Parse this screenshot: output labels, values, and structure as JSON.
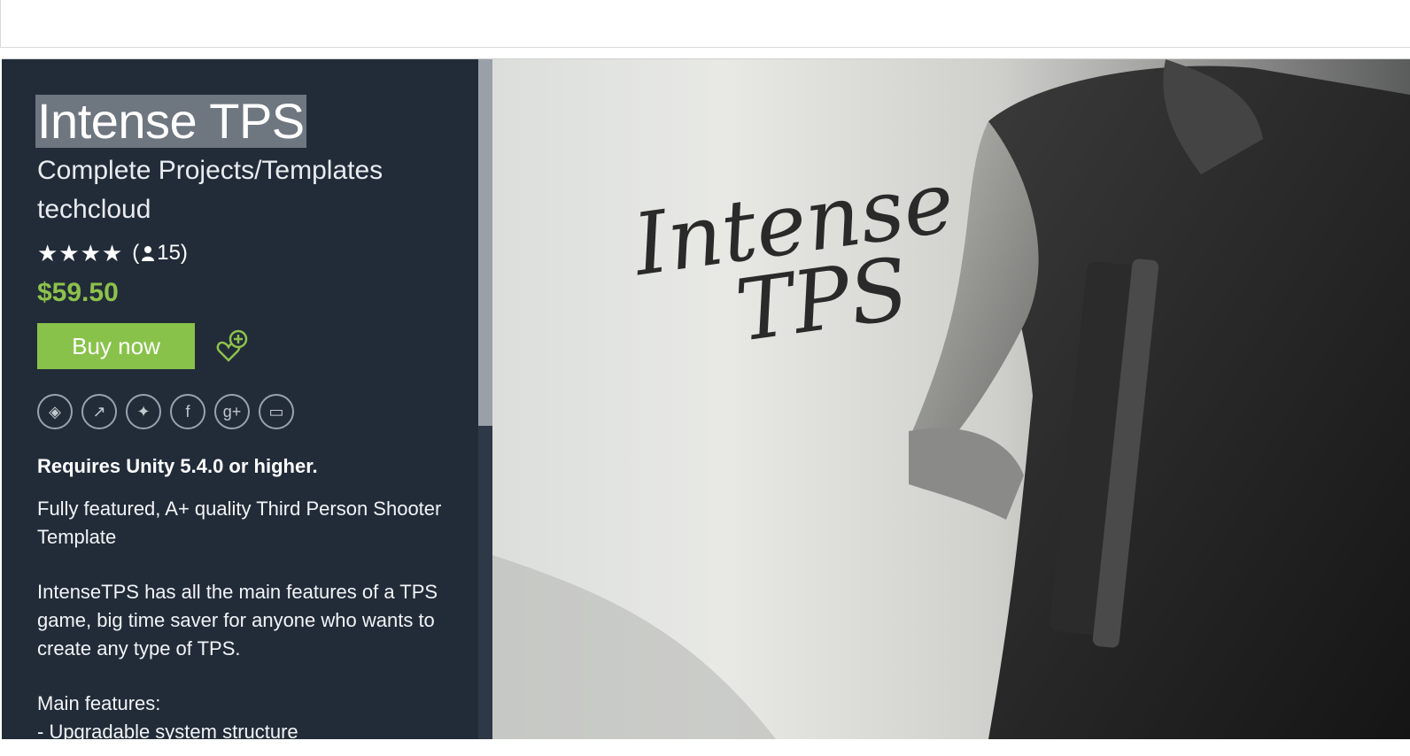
{
  "product": {
    "title": "Intense TPS",
    "category": "Complete Projects/Templates",
    "publisher": "techcloud",
    "stars": "★★★★",
    "rating_count_open": "(",
    "rating_count": "15)",
    "price": "$59.50",
    "buy_label": "Buy now",
    "requirement": "Requires Unity 5.4.0 or higher.",
    "description": [
      "Fully featured, A+ quality Third Person Shooter Template",
      "IntenseTPS has all the main features of a TPS game, big time saver for anyone who wants to create any type of TPS.",
      "Main features:",
      "- Upgradable system structure"
    ]
  },
  "hero": {
    "logo_line1": "Intense",
    "logo_line2": "TPS"
  },
  "social_icons": [
    "unity-icon",
    "share-icon",
    "twitter-icon",
    "facebook-icon",
    "google-plus-icon",
    "comment-icon"
  ],
  "colors": {
    "panel_bg": "#222c39",
    "buy_green": "#88c24a",
    "price_green": "#8dc24b"
  }
}
